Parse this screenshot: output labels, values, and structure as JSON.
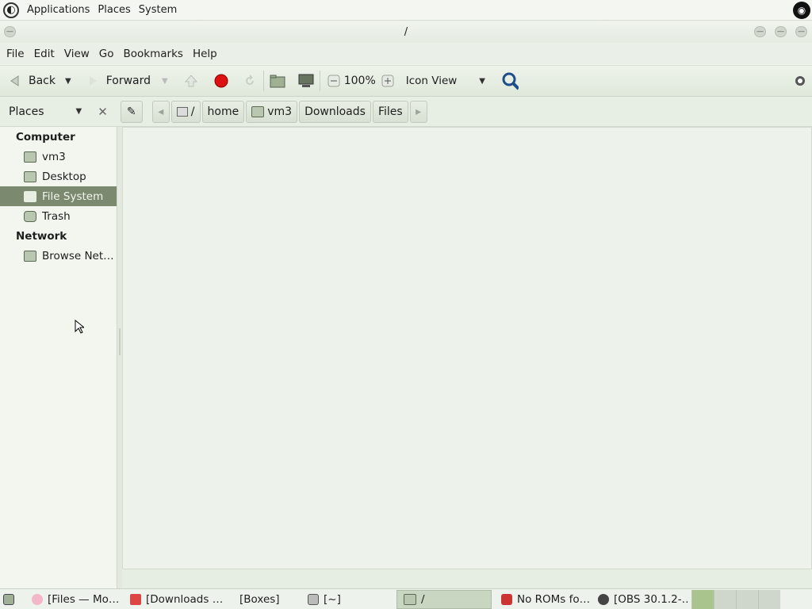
{
  "top_panel": {
    "menus": [
      "Applications",
      "Places",
      "System"
    ]
  },
  "window": {
    "title": "/"
  },
  "menubar": [
    "File",
    "Edit",
    "View",
    "Go",
    "Bookmarks",
    "Help"
  ],
  "toolbar": {
    "back_label": "Back",
    "forward_label": "Forward",
    "zoom": "100%",
    "view_mode": "Icon View"
  },
  "sidebar": {
    "pane_label": "Places",
    "sections": [
      {
        "title": "Computer",
        "items": [
          "vm3",
          "Desktop",
          "File System",
          "Trash"
        ]
      },
      {
        "title": "Network",
        "items": [
          "Browse Net…"
        ]
      }
    ],
    "selected": "File System"
  },
  "location": {
    "root": "/",
    "crumbs": [
      "home",
      "vm3",
      "Downloads",
      "Files"
    ]
  },
  "taskbar": {
    "tasks": [
      "[Files — Mo…",
      "[Downloads …",
      "[Boxes]",
      "[~]",
      "/",
      "No ROMs fo…",
      "[OBS 30.1.2-…"
    ],
    "active_index": 4
  },
  "colors": {
    "selection": "#7b8a6f",
    "stop_red": "#d11",
    "workspace_active": "#a9c58d"
  }
}
